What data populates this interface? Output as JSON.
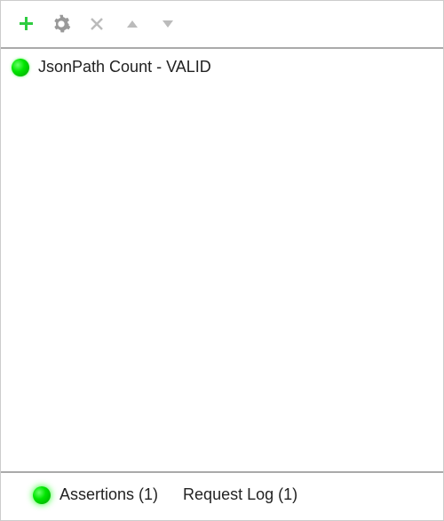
{
  "toolbar": {
    "icons": {
      "add": "plus-icon",
      "settings": "gear-icon",
      "remove": "close-icon",
      "moveUp": "caret-up-icon",
      "moveDown": "caret-down-icon"
    }
  },
  "assertions": {
    "items": [
      {
        "label": "JsonPath Count - VALID",
        "status": "valid",
        "status_color": "#00c400"
      }
    ]
  },
  "tabs": {
    "assertions": {
      "label": "Assertions (1)",
      "active": true,
      "status": "valid"
    },
    "requestLog": {
      "label": "Request Log (1)",
      "active": false
    }
  }
}
